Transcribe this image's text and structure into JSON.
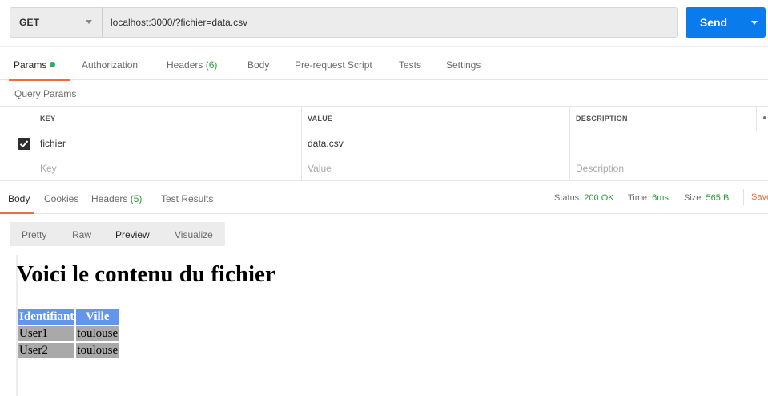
{
  "request": {
    "method": "GET",
    "url": "localhost:3000/?fichier=data.csv",
    "send_label": "Send"
  },
  "request_tabs": [
    {
      "label": "Params",
      "active": true,
      "dot_color": "#27ae60"
    },
    {
      "label": "Authorization"
    },
    {
      "label": "Headers",
      "count": "(6)"
    },
    {
      "label": "Body"
    },
    {
      "label": "Pre-request Script"
    },
    {
      "label": "Tests"
    },
    {
      "label": "Settings"
    }
  ],
  "query_params": {
    "section_label": "Query Params",
    "headers": [
      "KEY",
      "VALUE",
      "DESCRIPTION"
    ],
    "rows": [
      {
        "checked": true,
        "key": "fichier",
        "value": "data.csv",
        "description": ""
      }
    ],
    "placeholders": {
      "key": "Key",
      "value": "Value",
      "description": "Description"
    }
  },
  "response_tabs": [
    {
      "label": "Body",
      "active": true
    },
    {
      "label": "Cookies"
    },
    {
      "label": "Headers",
      "count": "(5)"
    },
    {
      "label": "Test Results"
    }
  ],
  "response_status": {
    "status_label": "Status:",
    "status_value": "200 OK",
    "time_label": "Time:",
    "time_value": "6ms",
    "size_label": "Size:",
    "size_value": "565 B",
    "save_label": "Save"
  },
  "view_options": [
    {
      "label": "Pretty"
    },
    {
      "label": "Raw"
    },
    {
      "label": "Preview",
      "active": true
    },
    {
      "label": "Visualize"
    }
  ],
  "preview": {
    "title": "Voici le contenu du fichier",
    "table_headers": [
      "Identifiant",
      "Ville"
    ],
    "table_rows": [
      [
        "User1",
        "toulouse"
      ],
      [
        "User2",
        "toulouse"
      ]
    ]
  },
  "colors": {
    "accent": "#f26b3a",
    "send_button": "#097bed",
    "success": "#2e9c3f",
    "preview_header": "#6495ed",
    "preview_cell": "#a9a9a9"
  }
}
